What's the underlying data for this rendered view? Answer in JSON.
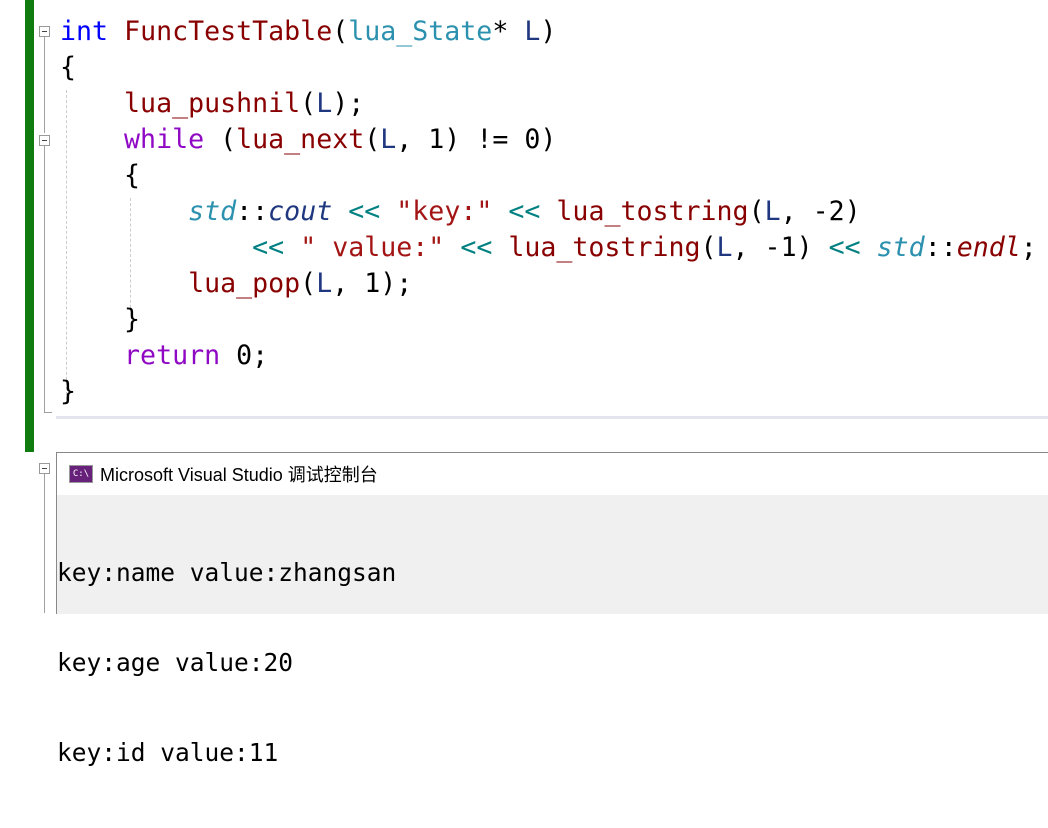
{
  "editor": {
    "lines": [
      [
        [
          "int",
          "kw"
        ],
        [
          " ",
          "pl"
        ],
        [
          "FuncTestTable",
          "fn"
        ],
        [
          "(",
          "pl"
        ],
        [
          "lua_State",
          "ty"
        ],
        [
          "* ",
          "pl"
        ],
        [
          "L",
          "pm"
        ],
        [
          ")",
          "pl"
        ]
      ],
      [
        [
          "{",
          "pl"
        ]
      ],
      [
        [
          "    ",
          "pl"
        ],
        [
          "lua_pushnil",
          "fn"
        ],
        [
          "(",
          "pl"
        ],
        [
          "L",
          "pm"
        ],
        [
          ");",
          "pl"
        ]
      ],
      [
        [
          "    ",
          "pl"
        ],
        [
          "while",
          "ctl"
        ],
        [
          " (",
          "pl"
        ],
        [
          "lua_next",
          "fn"
        ],
        [
          "(",
          "pl"
        ],
        [
          "L",
          "pm"
        ],
        [
          ", 1) != 0)",
          "pl"
        ]
      ],
      [
        [
          "    {",
          "pl"
        ]
      ],
      [
        [
          "        ",
          "pl"
        ],
        [
          "std",
          "ns"
        ],
        [
          "::",
          "pl"
        ],
        [
          "cout",
          "gv"
        ],
        [
          " ",
          "pl"
        ],
        [
          "<<",
          "op"
        ],
        [
          " ",
          "pl"
        ],
        [
          "\"key:\"",
          "str"
        ],
        [
          " ",
          "pl"
        ],
        [
          "<<",
          "op"
        ],
        [
          " ",
          "pl"
        ],
        [
          "lua_tostring",
          "fn"
        ],
        [
          "(",
          "pl"
        ],
        [
          "L",
          "pm"
        ],
        [
          ", -2)",
          "pl"
        ]
      ],
      [
        [
          "            ",
          "pl"
        ],
        [
          "<<",
          "op"
        ],
        [
          " ",
          "pl"
        ],
        [
          "\" value:\"",
          "str"
        ],
        [
          " ",
          "pl"
        ],
        [
          "<<",
          "op"
        ],
        [
          " ",
          "pl"
        ],
        [
          "lua_tostring",
          "fn"
        ],
        [
          "(",
          "pl"
        ],
        [
          "L",
          "pm"
        ],
        [
          ", -1) ",
          "pl"
        ],
        [
          "<<",
          "op"
        ],
        [
          " ",
          "pl"
        ],
        [
          "std",
          "ns"
        ],
        [
          "::",
          "pl"
        ],
        [
          "endl",
          "fi"
        ],
        [
          ";",
          "pl"
        ]
      ],
      [
        [
          "        ",
          "pl"
        ],
        [
          "lua_pop",
          "fn"
        ],
        [
          "(",
          "pl"
        ],
        [
          "L",
          "pm"
        ],
        [
          ", 1);",
          "pl"
        ]
      ],
      [
        [
          "    }",
          "pl"
        ]
      ],
      [
        [
          "    ",
          "pl"
        ],
        [
          "return",
          "ctl"
        ],
        [
          " 0;",
          "pl"
        ]
      ],
      [
        [
          "}",
          "pl"
        ]
      ]
    ]
  },
  "console": {
    "title": "Microsoft Visual Studio 调试控制台",
    "icon": "console-app-icon",
    "icon_text": "C:\\",
    "output": [
      "key:name value:zhangsan",
      "key:age value:20",
      "key:id value:11"
    ]
  }
}
